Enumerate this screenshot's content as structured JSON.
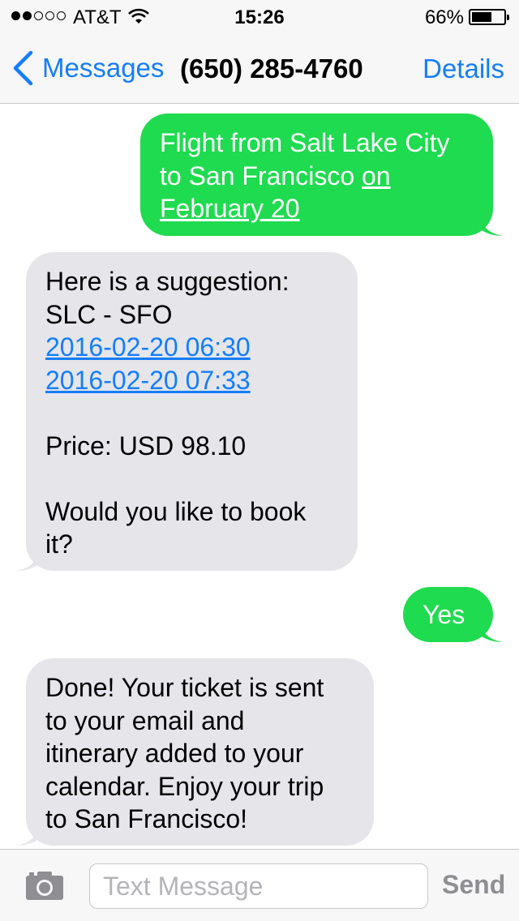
{
  "status_bar": {
    "carrier": "AT&T",
    "signal_bars_filled": 2,
    "signal_bars_total": 5,
    "time": "15:26",
    "battery_percent_label": "66%",
    "battery_level": 0.66
  },
  "nav": {
    "back_label": "Messages",
    "title": "(650) 285-4760",
    "details_label": "Details"
  },
  "messages": [
    {
      "direction": "sent",
      "lines": [
        [
          "Flight from Salt Lake City"
        ],
        [
          "to San Francisco ",
          "on"
        ],
        [
          "February 20"
        ]
      ],
      "link_text": "on February 20"
    },
    {
      "direction": "received",
      "lines": [
        "Here is a suggestion:",
        "SLC - SFO",
        "2016-02-20 06:30",
        "2016-02-20 07:33",
        "",
        "Price: USD 98.10",
        "",
        "Would you like to book",
        "it?"
      ]
    },
    {
      "direction": "sent",
      "lines": [
        "Yes"
      ]
    },
    {
      "direction": "received",
      "lines": [
        "Done! Your ticket is sent",
        "to your email and",
        "itinerary added to your",
        "calendar. Enjoy your trip",
        "to San Francisco!"
      ]
    }
  ],
  "input_bar": {
    "camera_icon": "camera-icon",
    "placeholder": "Text Message",
    "value": "",
    "send_label": "Send"
  },
  "colors": {
    "sent_bubble": "#1fdb4f",
    "received_bubble": "#e5e5ea",
    "link_blue": "#147efb",
    "send_disabled": "#8e8e93"
  }
}
